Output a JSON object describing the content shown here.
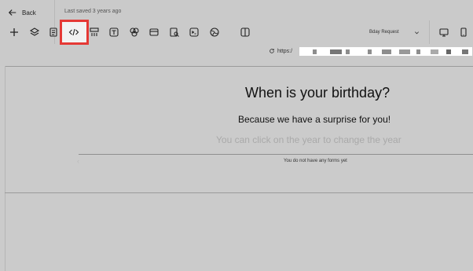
{
  "header": {
    "back_label": "Back",
    "last_saved": "Last saved 3 years ago"
  },
  "toolbar": {
    "tools": [
      "plus-icon",
      "layers-icon",
      "form-icon",
      "code-icon",
      "component-icon",
      "text-icon",
      "shapes-icon",
      "panel-icon",
      "search-doc-icon",
      "terminal-icon",
      "globe-icon",
      "split-view-icon"
    ],
    "selected_tool": "code-icon",
    "dropdown_value": "Bday Request",
    "devices": [
      "desktop-icon",
      "mobile-icon"
    ]
  },
  "urlbar": {
    "prefix": "https:/"
  },
  "preview": {
    "title": "When is your birthday?",
    "subtitle": "Because we have a surprise for you!",
    "hint": "You can click on the year to change the year",
    "empty_message": "You do not have any forms yet"
  }
}
